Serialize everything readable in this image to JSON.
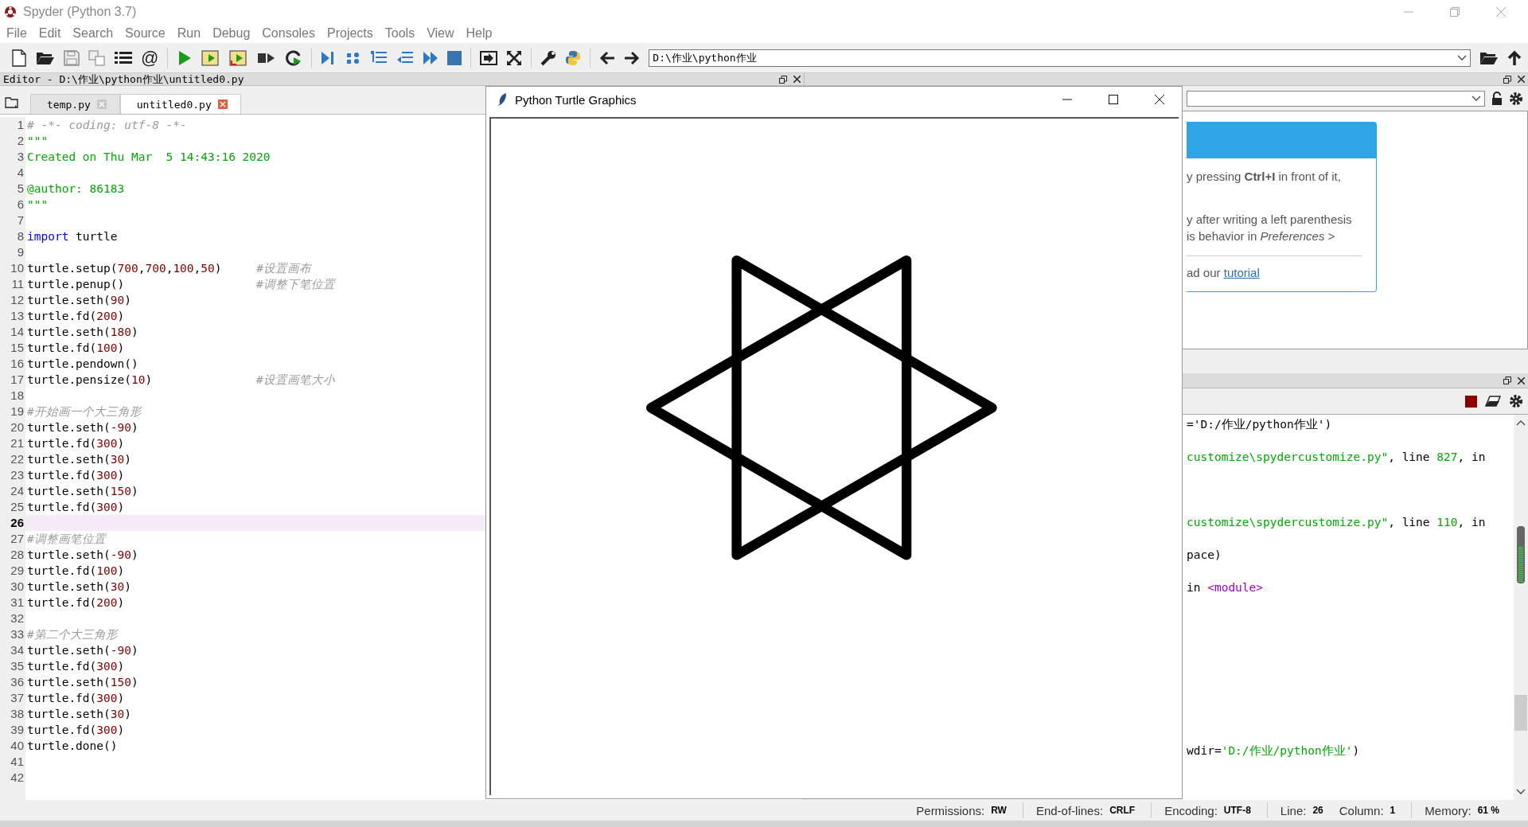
{
  "window": {
    "title": "Spyder (Python 3.7)"
  },
  "menu": [
    "File",
    "Edit",
    "Search",
    "Source",
    "Run",
    "Debug",
    "Consoles",
    "Projects",
    "Tools",
    "View",
    "Help"
  ],
  "toolbar": {
    "at_button": "@",
    "path_field": {
      "value": "D:\\作业\\python作业"
    }
  },
  "editor": {
    "title": "Editor - D:\\作业\\python作业\\untitled0.py",
    "tabs": [
      {
        "label": "temp.py",
        "selected": false
      },
      {
        "label": "untitled0.py",
        "selected": true
      }
    ],
    "lines": [
      {
        "number": "1",
        "current": false,
        "tokens": [
          {
            "text": "# -*- coding: utf-8 -*-",
            "kind": "comment"
          }
        ]
      },
      {
        "number": "2",
        "current": false,
        "tokens": [
          {
            "text": "\"\"\"",
            "kind": "string"
          }
        ]
      },
      {
        "number": "3",
        "current": false,
        "tokens": [
          {
            "text": "Created on Thu Mar  5 14:43:16 2020",
            "kind": "string"
          }
        ]
      },
      {
        "number": "4",
        "current": false
      },
      {
        "number": "5",
        "current": false,
        "tokens": [
          {
            "text": "@author: 86183",
            "kind": "string"
          }
        ]
      },
      {
        "number": "6",
        "current": false,
        "tokens": [
          {
            "text": "\"\"\"",
            "kind": "string"
          }
        ]
      },
      {
        "number": "7",
        "current": false
      },
      {
        "number": "8",
        "current": false,
        "tokens": [
          {
            "text": "import",
            "kind": "keyword"
          },
          {
            "text": " turtle",
            "kind": "plain"
          }
        ]
      },
      {
        "number": "9",
        "current": false
      },
      {
        "number": "10",
        "current": false,
        "tokens": [
          {
            "text": "turtle.setup(",
            "kind": "plain"
          },
          {
            "text": "700",
            "kind": "number"
          },
          {
            "text": ",",
            "kind": "plain"
          },
          {
            "text": "700",
            "kind": "number"
          },
          {
            "text": ",",
            "kind": "plain"
          },
          {
            "text": "100",
            "kind": "number"
          },
          {
            "text": ",",
            "kind": "plain"
          },
          {
            "text": "50",
            "kind": "number"
          },
          {
            "text": ")     ",
            "kind": "plain"
          },
          {
            "text": "#设置画布",
            "kind": "comment"
          }
        ]
      },
      {
        "number": "11",
        "current": false,
        "tokens": [
          {
            "text": "turtle.penup()                   ",
            "kind": "plain"
          },
          {
            "text": "#调整下笔位置",
            "kind": "comment"
          }
        ]
      },
      {
        "number": "12",
        "current": false,
        "tokens": [
          {
            "text": "turtle.seth(",
            "kind": "plain"
          },
          {
            "text": "90",
            "kind": "number"
          },
          {
            "text": ")",
            "kind": "plain"
          }
        ]
      },
      {
        "number": "13",
        "current": false,
        "tokens": [
          {
            "text": "turtle.fd(",
            "kind": "plain"
          },
          {
            "text": "200",
            "kind": "number"
          },
          {
            "text": ")",
            "kind": "plain"
          }
        ]
      },
      {
        "number": "14",
        "current": false,
        "tokens": [
          {
            "text": "turtle.seth(",
            "kind": "plain"
          },
          {
            "text": "180",
            "kind": "number"
          },
          {
            "text": ")",
            "kind": "plain"
          }
        ]
      },
      {
        "number": "15",
        "current": false,
        "tokens": [
          {
            "text": "turtle.fd(",
            "kind": "plain"
          },
          {
            "text": "100",
            "kind": "number"
          },
          {
            "text": ")",
            "kind": "plain"
          }
        ]
      },
      {
        "number": "16",
        "current": false,
        "tokens": [
          {
            "text": "turtle.pendown()",
            "kind": "plain"
          }
        ]
      },
      {
        "number": "17",
        "current": false,
        "tokens": [
          {
            "text": "turtle.pensize(",
            "kind": "plain"
          },
          {
            "text": "10",
            "kind": "number"
          },
          {
            "text": ")               ",
            "kind": "plain"
          },
          {
            "text": "#设置画笔大小",
            "kind": "comment"
          }
        ]
      },
      {
        "number": "18",
        "current": false
      },
      {
        "number": "19",
        "current": false,
        "tokens": [
          {
            "text": "#开始画一个大三角形",
            "kind": "comment"
          }
        ]
      },
      {
        "number": "20",
        "current": false,
        "tokens": [
          {
            "text": "turtle.seth(",
            "kind": "plain"
          },
          {
            "text": "-90",
            "kind": "number"
          },
          {
            "text": ")",
            "kind": "plain"
          }
        ]
      },
      {
        "number": "21",
        "current": false,
        "tokens": [
          {
            "text": "turtle.fd(",
            "kind": "plain"
          },
          {
            "text": "300",
            "kind": "number"
          },
          {
            "text": ")",
            "kind": "plain"
          }
        ]
      },
      {
        "number": "22",
        "current": false,
        "tokens": [
          {
            "text": "turtle.seth(",
            "kind": "plain"
          },
          {
            "text": "30",
            "kind": "number"
          },
          {
            "text": ")",
            "kind": "plain"
          }
        ]
      },
      {
        "number": "23",
        "current": false,
        "tokens": [
          {
            "text": "turtle.fd(",
            "kind": "plain"
          },
          {
            "text": "300",
            "kind": "number"
          },
          {
            "text": ")",
            "kind": "plain"
          }
        ]
      },
      {
        "number": "24",
        "current": false,
        "tokens": [
          {
            "text": "turtle.seth(",
            "kind": "plain"
          },
          {
            "text": "150",
            "kind": "number"
          },
          {
            "text": ")",
            "kind": "plain"
          }
        ]
      },
      {
        "number": "25",
        "current": false,
        "tokens": [
          {
            "text": "turtle.fd(",
            "kind": "plain"
          },
          {
            "text": "300",
            "kind": "number"
          },
          {
            "text": ")",
            "kind": "plain"
          }
        ]
      },
      {
        "number": "26",
        "current": true
      },
      {
        "number": "27",
        "current": false,
        "tokens": [
          {
            "text": "#调整画笔位置",
            "kind": "comment"
          }
        ]
      },
      {
        "number": "28",
        "current": false,
        "tokens": [
          {
            "text": "turtle.seth(",
            "kind": "plain"
          },
          {
            "text": "-90",
            "kind": "number"
          },
          {
            "text": ")",
            "kind": "plain"
          }
        ]
      },
      {
        "number": "29",
        "current": false,
        "tokens": [
          {
            "text": "turtle.fd(",
            "kind": "plain"
          },
          {
            "text": "100",
            "kind": "number"
          },
          {
            "text": ")",
            "kind": "plain"
          }
        ]
      },
      {
        "number": "30",
        "current": false,
        "tokens": [
          {
            "text": "turtle.seth(",
            "kind": "plain"
          },
          {
            "text": "30",
            "kind": "number"
          },
          {
            "text": ")",
            "kind": "plain"
          }
        ]
      },
      {
        "number": "31",
        "current": false,
        "tokens": [
          {
            "text": "turtle.fd(",
            "kind": "plain"
          },
          {
            "text": "200",
            "kind": "number"
          },
          {
            "text": ")",
            "kind": "plain"
          }
        ]
      },
      {
        "number": "32",
        "current": false
      },
      {
        "number": "33",
        "current": false,
        "tokens": [
          {
            "text": "#第二个大三角形",
            "kind": "comment"
          }
        ]
      },
      {
        "number": "34",
        "current": false,
        "tokens": [
          {
            "text": "turtle.seth(",
            "kind": "plain"
          },
          {
            "text": "-90",
            "kind": "number"
          },
          {
            "text": ")",
            "kind": "plain"
          }
        ]
      },
      {
        "number": "35",
        "current": false,
        "tokens": [
          {
            "text": "turtle.fd(",
            "kind": "plain"
          },
          {
            "text": "300",
            "kind": "number"
          },
          {
            "text": ")",
            "kind": "plain"
          }
        ]
      },
      {
        "number": "36",
        "current": false,
        "tokens": [
          {
            "text": "turtle.seth(",
            "kind": "plain"
          },
          {
            "text": "150",
            "kind": "number"
          },
          {
            "text": ")",
            "kind": "plain"
          }
        ]
      },
      {
        "number": "37",
        "current": false,
        "tokens": [
          {
            "text": "turtle.fd(",
            "kind": "plain"
          },
          {
            "text": "300",
            "kind": "number"
          },
          {
            "text": ")",
            "kind": "plain"
          }
        ]
      },
      {
        "number": "38",
        "current": false,
        "tokens": [
          {
            "text": "turtle.seth(",
            "kind": "plain"
          },
          {
            "text": "30",
            "kind": "number"
          },
          {
            "text": ")",
            "kind": "plain"
          }
        ]
      },
      {
        "number": "39",
        "current": false,
        "tokens": [
          {
            "text": "turtle.fd(",
            "kind": "plain"
          },
          {
            "text": "300",
            "kind": "number"
          },
          {
            "text": ")",
            "kind": "plain"
          }
        ]
      },
      {
        "number": "40",
        "current": false,
        "tokens": [
          {
            "text": "turtle.done()",
            "kind": "plain"
          }
        ]
      },
      {
        "number": "41",
        "current": false
      },
      {
        "number": "42",
        "current": false
      }
    ]
  },
  "turtle_window": {
    "title": "Python Turtle Graphics"
  },
  "help": {
    "lines": [
      "y pressing **Ctrl+I** in front of it,",
      "y after writing a left parenthesis",
      "is behavior in *Preferences >*"
    ],
    "link_line": {
      "text": "ad our",
      "link": "tutorial"
    }
  },
  "console": {
    "lines": [
      {
        "tokens": [
          {
            "text": "='D:/作业/python作业')",
            "kind": "plain"
          }
        ]
      },
      {
        "tokens": [
          {
            "text": "customize\\spydercustomize.py\"",
            "kind": "string"
          },
          {
            "text": ", line ",
            "kind": "plain"
          },
          {
            "text": "827",
            "kind": "string"
          },
          {
            "text": ", in",
            "kind": "plain"
          }
        ]
      },
      {
        "tokens": [
          {
            "text": "customize\\spydercustomize.py\"",
            "kind": "string"
          },
          {
            "text": ", line ",
            "kind": "plain"
          },
          {
            "text": "110",
            "kind": "string"
          },
          {
            "text": ", in",
            "kind": "plain"
          }
        ]
      },
      {
        "tokens": [
          {
            "text": "pace)",
            "kind": "plain"
          }
        ]
      },
      {
        "tokens": [
          {
            "text": "in ",
            "kind": "plain"
          },
          {
            "text": "<module>",
            "kind": "module"
          }
        ]
      },
      {
        "tokens": [
          {
            "text": "wdir=",
            "kind": "plain"
          },
          {
            "text": "'D:/作业/python作业'",
            "kind": "string"
          },
          {
            "text": ")",
            "kind": "plain"
          }
        ]
      }
    ]
  },
  "status_bar": [
    {
      "label": "Permissions:",
      "value": "RW"
    },
    {
      "label": "End-of-lines:",
      "value": "CRLF"
    },
    {
      "label": "Encoding:",
      "value": "UTF-8"
    },
    {
      "label": "Line:",
      "value": "26"
    },
    {
      "label": "Column:",
      "value": "1"
    },
    {
      "label": "Memory:",
      "value": "61 %"
    }
  ]
}
